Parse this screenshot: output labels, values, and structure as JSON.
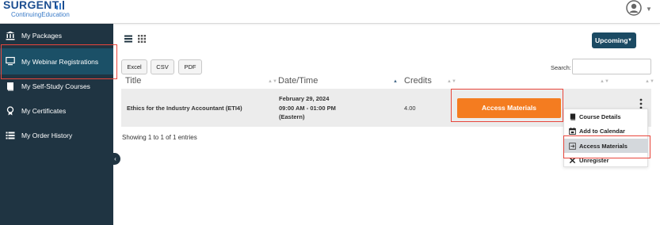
{
  "brand": {
    "name": "SURGENT",
    "tagline": "ContinuingEducation"
  },
  "sidebar": {
    "items": [
      {
        "label": "My Packages",
        "icon": "bank-icon"
      },
      {
        "label": "My Webinar Registrations",
        "icon": "monitor-icon",
        "active": true
      },
      {
        "label": "My Self-Study Courses",
        "icon": "book-icon"
      },
      {
        "label": "My Certificates",
        "icon": "badge-icon"
      },
      {
        "label": "My Order History",
        "icon": "list-icon"
      }
    ]
  },
  "filter": {
    "selected": "Upcoming"
  },
  "export_buttons": [
    "Excel",
    "CSV",
    "PDF"
  ],
  "search": {
    "label": "Search:",
    "value": ""
  },
  "table": {
    "columns": [
      "Title",
      "Date/Time",
      "Credits"
    ],
    "rows": [
      {
        "title": "Ethics for the Industry Accountant (ETI4)",
        "date": "February 29, 2024",
        "time": "09:00 AM - 01:00 PM",
        "tz": "(Eastern)",
        "credits": "4.00",
        "action": "Access Materials"
      }
    ]
  },
  "info": "Showing 1 to 1 of 1 entries",
  "row_menu": {
    "items": [
      {
        "label": "Course Details",
        "icon": "book-icon"
      },
      {
        "label": "Add to Calendar",
        "icon": "calendar-icon"
      },
      {
        "label": "Access Materials",
        "icon": "materials-icon",
        "highlighted": true
      },
      {
        "label": "Unregister",
        "icon": "x-icon"
      }
    ]
  },
  "colors": {
    "sidebar_bg": "#1f3442",
    "sidebar_active": "#1b5067",
    "accent_orange": "#f47c20",
    "primary_button": "#1b4a63",
    "annotation_red": "#e8463c"
  }
}
